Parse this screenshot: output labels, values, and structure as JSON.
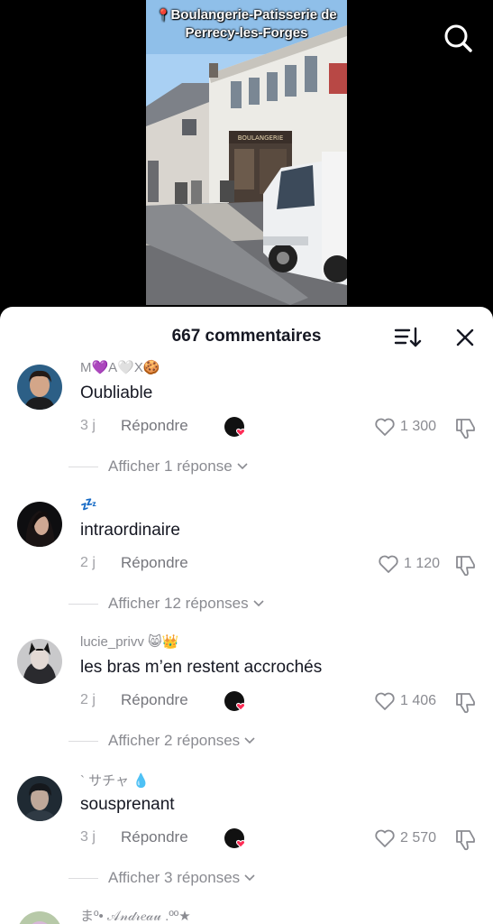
{
  "video": {
    "location": "Boulangerie-Patisserie de Perrecy-les-Forges",
    "shop_sign": "BOULANGERIE"
  },
  "comments_panel": {
    "title": "667 commentaires",
    "comments": [
      {
        "username": "M💜A🤍X🍪",
        "text": "Oubliable",
        "age": "3 j",
        "reply_label": "Répondre",
        "likes": "1 300",
        "creator_liked": true,
        "replies_label": "Afficher 1 réponse"
      },
      {
        "username": "💤",
        "text": "intraordinaire",
        "age": "2 j",
        "reply_label": "Répondre",
        "likes": "1 120",
        "creator_liked": false,
        "replies_label": "Afficher 12 réponses"
      },
      {
        "username": "lucie_privv 😸👑",
        "text": "les bras m’en restent accrochés",
        "age": "2 j",
        "reply_label": "Répondre",
        "likes": "1 406",
        "creator_liked": true,
        "replies_label": "Afficher 2 réponses"
      },
      {
        "username": "` サチャ 💧",
        "text": "sousprenant",
        "age": "3 j",
        "reply_label": "Répondre",
        "likes": "2 570",
        "creator_liked": true,
        "replies_label": "Afficher 3 réponses"
      }
    ],
    "partial_next_username": "まº• 𝒜𝓃𝒹𝓇𝑒𝒶𝓊 .ºº★"
  },
  "colors": {
    "text_primary": "#161823",
    "text_secondary": "#8a8b91",
    "heart_badge": "#fe2c55",
    "sky": "#9cc7ee"
  }
}
